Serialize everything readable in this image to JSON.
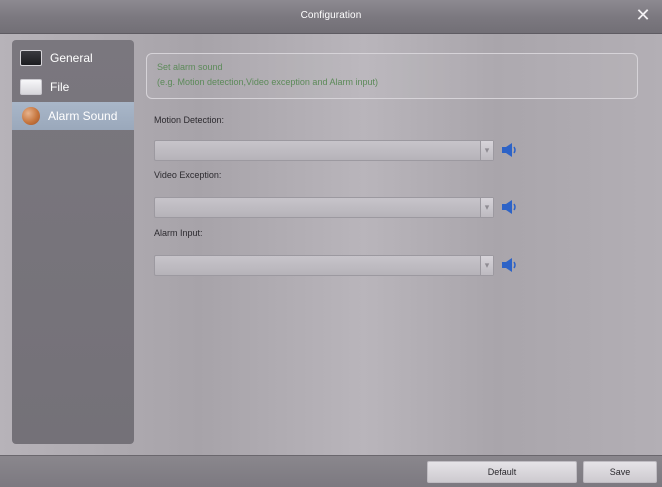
{
  "window": {
    "title": "Configuration",
    "close_glyph": "✕"
  },
  "sidebar": {
    "items": [
      {
        "label": "General",
        "icon": "monitor-icon"
      },
      {
        "label": "File",
        "icon": "folder-icon"
      },
      {
        "label": "Alarm Sound",
        "icon": "alarm-icon",
        "selected": true
      }
    ]
  },
  "main": {
    "hint_title": "Set alarm sound",
    "hint_example": "(e.g. Motion detection,Video exception  and  Alarm input)",
    "fields": [
      {
        "label": "Motion Detection:",
        "value": ""
      },
      {
        "label": "Video Exception:",
        "value": ""
      },
      {
        "label": "Alarm Input:",
        "value": ""
      }
    ]
  },
  "footer": {
    "default_label": "Default",
    "save_label": "Save"
  },
  "colors": {
    "hint_text": "#5c8a59",
    "selected_item": "#a9b7c9",
    "speaker_blue": "#2d63c7"
  }
}
